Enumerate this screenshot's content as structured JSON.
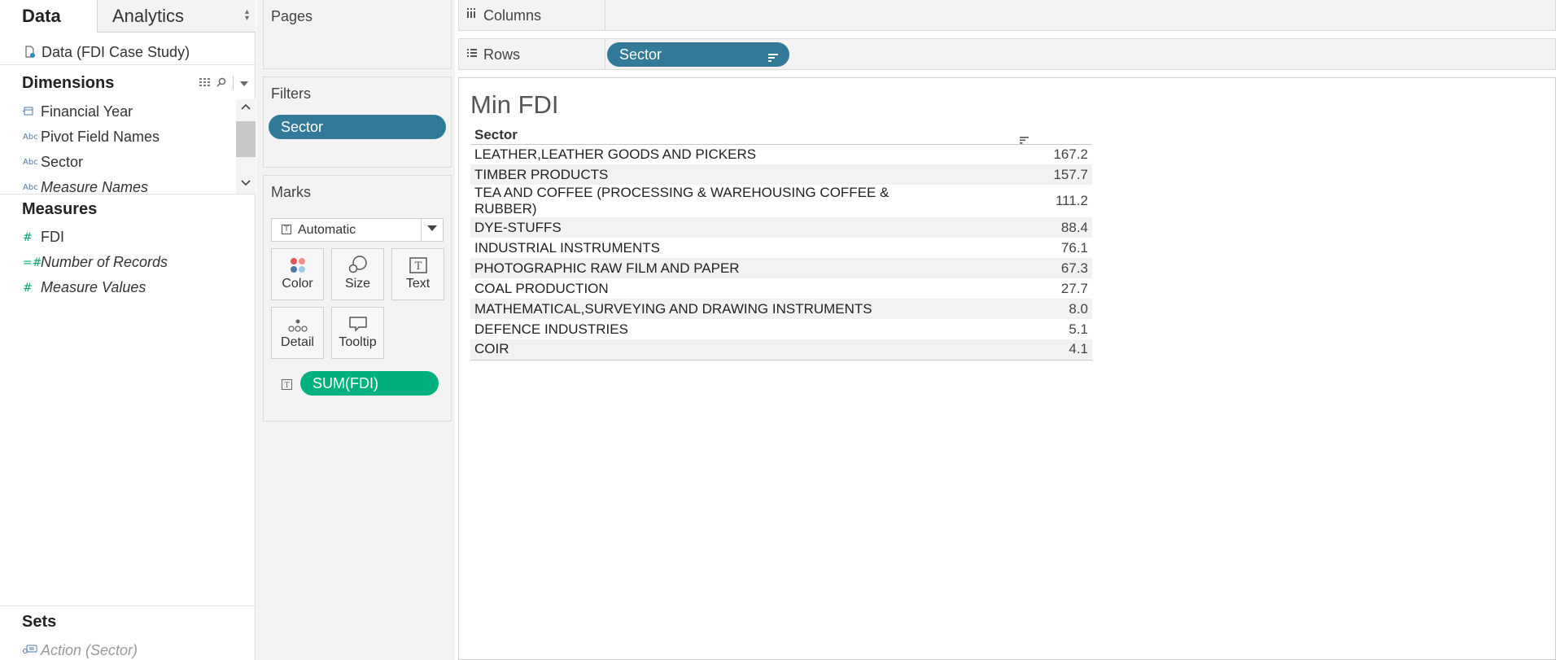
{
  "left_pane": {
    "tabs": {
      "data": "Data",
      "analytics": "Analytics"
    },
    "datasource": "Data (FDI Case Study)",
    "dimensions_title": "Dimensions",
    "dimensions": [
      {
        "label": "Financial Year",
        "icon": "calendar-icon",
        "italic": false
      },
      {
        "label": "Pivot Field Names",
        "icon": "abc-icon",
        "italic": false
      },
      {
        "label": "Sector",
        "icon": "abc-icon",
        "italic": false
      },
      {
        "label": "Measure Names",
        "icon": "abc-icon",
        "italic": true
      }
    ],
    "measures_title": "Measures",
    "measures": [
      {
        "label": "FDI",
        "icon": "hash-icon",
        "italic": false
      },
      {
        "label": "Number of Records",
        "icon": "hash-calc-icon",
        "italic": true
      },
      {
        "label": "Measure Values",
        "icon": "hash-icon",
        "italic": true
      }
    ],
    "sets_title": "Sets",
    "sets": [
      {
        "label": "Action (Sector)",
        "icon": "set-icon",
        "italic": true
      }
    ]
  },
  "cards": {
    "pages_title": "Pages",
    "filters_title": "Filters",
    "filter_pill": "Sector",
    "marks_title": "Marks",
    "mark_type": "Automatic",
    "mark_buttons": [
      "Color",
      "Size",
      "Text",
      "Detail",
      "Tooltip"
    ],
    "marks_pill": "SUM(FDI)"
  },
  "shelves": {
    "columns_label": "Columns",
    "rows_label": "Rows",
    "rows_pill": "Sector"
  },
  "viz": {
    "title": "Min FDI",
    "header_sector": "Sector",
    "rows": [
      {
        "sector": "LEATHER,LEATHER GOODS AND PICKERS",
        "value": "167.2"
      },
      {
        "sector": "TIMBER PRODUCTS",
        "value": "157.7"
      },
      {
        "sector": "TEA AND COFFEE (PROCESSING & WAREHOUSING COFFEE & RUBBER)",
        "value": "111.2"
      },
      {
        "sector": "DYE-STUFFS",
        "value": "88.4"
      },
      {
        "sector": "INDUSTRIAL INSTRUMENTS",
        "value": "76.1"
      },
      {
        "sector": "PHOTOGRAPHIC RAW FILM AND PAPER",
        "value": "67.3"
      },
      {
        "sector": "COAL PRODUCTION",
        "value": "27.7"
      },
      {
        "sector": "MATHEMATICAL,SURVEYING AND DRAWING INSTRUMENTS",
        "value": "8.0"
      },
      {
        "sector": "DEFENCE INDUSTRIES",
        "value": "5.1"
      },
      {
        "sector": "COIR",
        "value": "4.1"
      }
    ]
  },
  "colors": {
    "dimension_pill": "#327a98",
    "measure_pill": "#00b180"
  }
}
